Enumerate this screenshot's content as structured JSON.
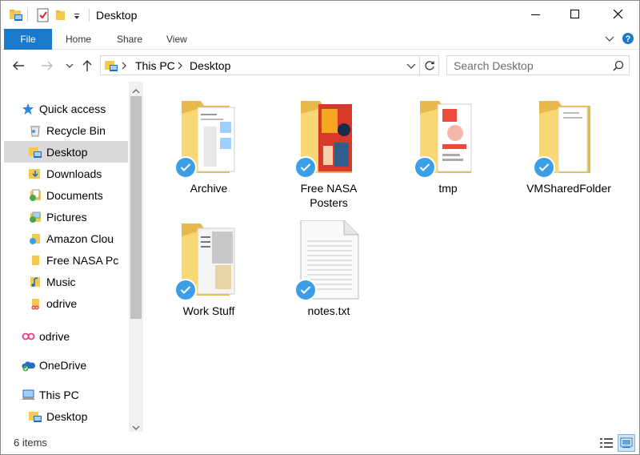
{
  "window": {
    "title": "Desktop"
  },
  "ribbon": {
    "tabs": [
      "File",
      "Home",
      "Share",
      "View"
    ]
  },
  "address": {
    "crumbs": [
      "This PC",
      "Desktop"
    ]
  },
  "search": {
    "placeholder": "Search Desktop"
  },
  "nav": {
    "quick_access": "Quick access",
    "quick_items": [
      {
        "label": "Recycle Bin",
        "icon": "recycle-bin-icon"
      },
      {
        "label": "Desktop",
        "icon": "desktop-folder-icon",
        "selected": true
      },
      {
        "label": "Downloads",
        "icon": "downloads-folder-icon"
      },
      {
        "label": "Documents",
        "icon": "documents-folder-icon"
      },
      {
        "label": "Pictures",
        "icon": "pictures-folder-icon"
      },
      {
        "label": "Amazon Clou",
        "icon": "folder-icon"
      },
      {
        "label": "Free NASA Pc",
        "icon": "folder-icon"
      },
      {
        "label": "Music",
        "icon": "music-folder-icon"
      },
      {
        "label": "odrive",
        "icon": "odrive-folder-icon"
      }
    ],
    "odrive": "odrive",
    "onedrive": "OneDrive",
    "thispc": "This PC",
    "thispc_items": [
      {
        "label": "Desktop",
        "icon": "desktop-folder-icon"
      }
    ]
  },
  "files": [
    {
      "name": "Archive",
      "type": "folder"
    },
    {
      "name": "Free NASA\nPosters",
      "type": "folder"
    },
    {
      "name": "tmp",
      "type": "folder"
    },
    {
      "name": "VMSharedFolder",
      "type": "folder"
    },
    {
      "name": "Work Stuff",
      "type": "folder"
    },
    {
      "name": "notes.txt",
      "type": "text-file"
    }
  ],
  "status": {
    "count": "6 items"
  },
  "colors": {
    "accent": "#1979ca",
    "check": "#3d9ee8",
    "folder": "#f8d775",
    "folder_dark": "#e8b94a",
    "nav_selected": "#d9d9d9"
  }
}
